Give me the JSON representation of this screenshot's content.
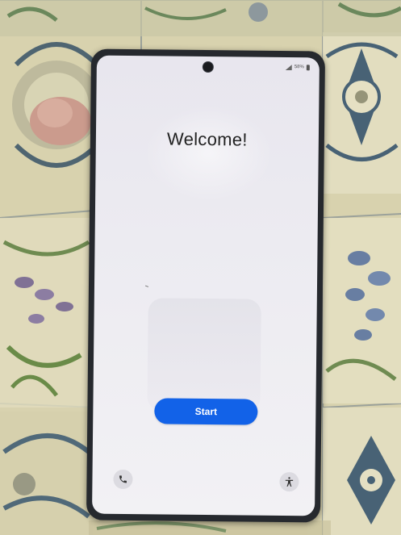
{
  "status_bar": {
    "battery_text": "58%"
  },
  "screen": {
    "title": "Welcome!",
    "start_label": "Start"
  },
  "icons": {
    "camera": "camera-cutout",
    "signal": "signal-icon",
    "battery": "battery-icon",
    "call": "phone-icon",
    "accessibility": "accessibility-icon"
  },
  "colors": {
    "start_button": "#1262e8",
    "screen_bg": "#ecebf1",
    "phone_body": "#26292e"
  }
}
